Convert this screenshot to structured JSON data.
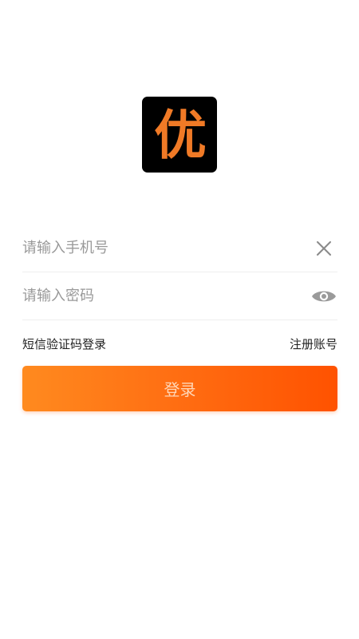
{
  "app": {
    "logo_char": "优",
    "brand_color": "#f07a26"
  },
  "login_form": {
    "phone_field": {
      "value": "",
      "placeholder": "请输入手机号",
      "clear_icon": "close-icon"
    },
    "password_field": {
      "value": "",
      "placeholder": "请输入密码",
      "toggle_icon": "eye-icon"
    },
    "sms_login_label": "短信验证码登录",
    "register_label": "注册账号",
    "submit_label": "登录",
    "submit_colors": {
      "from": "#ff8a1f",
      "to": "#ff5200",
      "text": "#ffd7b8"
    }
  }
}
